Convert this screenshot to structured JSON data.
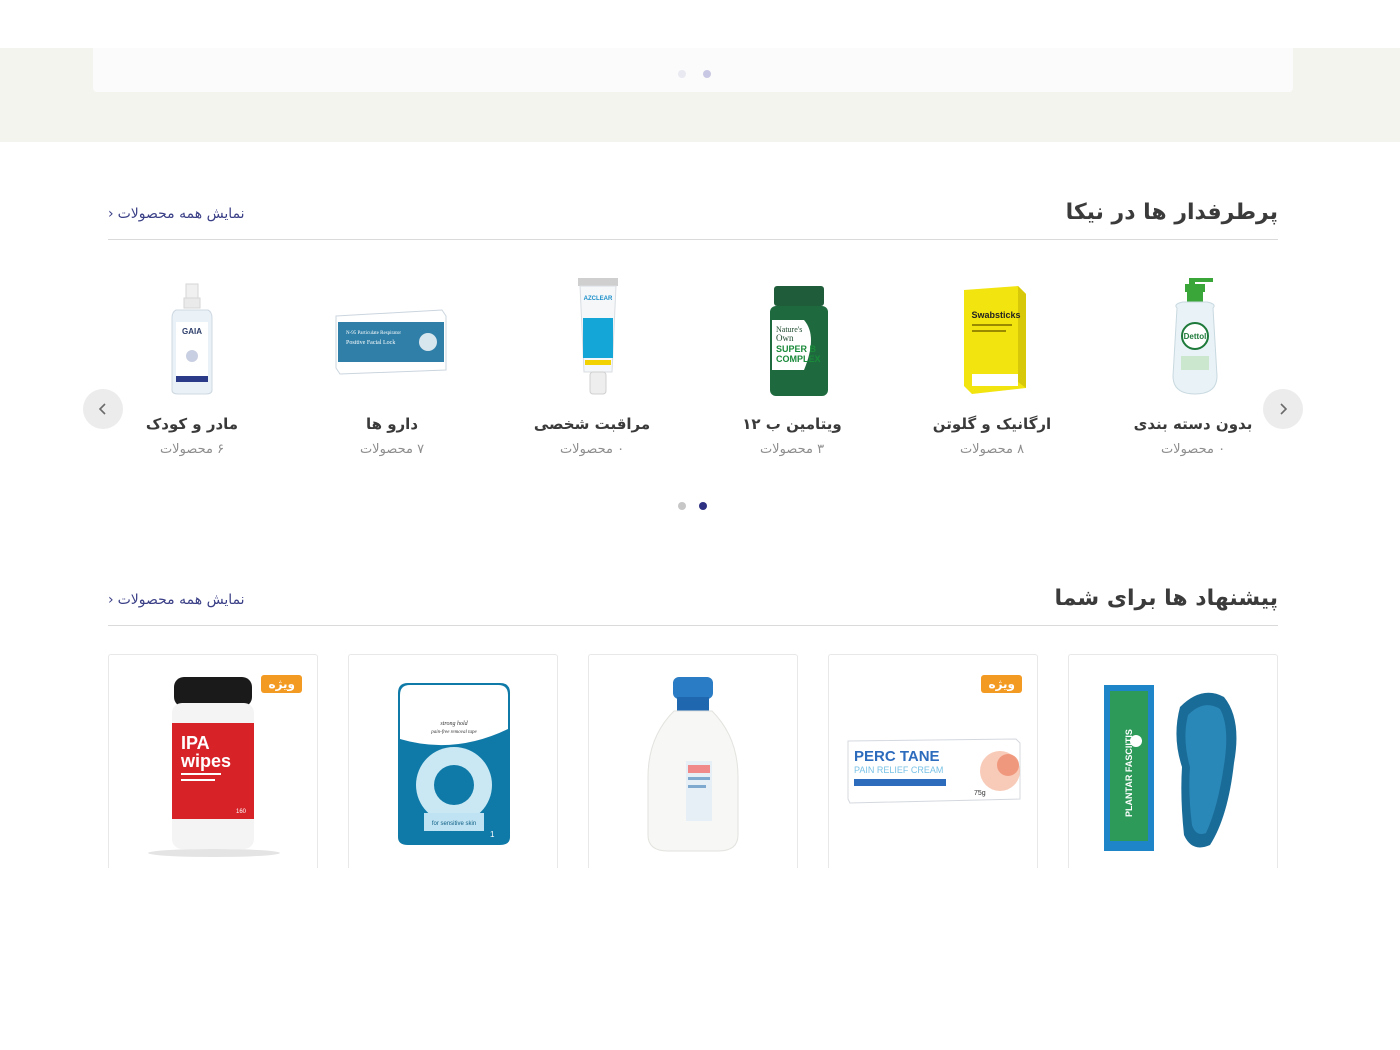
{
  "banner": {
    "dots": [
      {
        "active": false
      },
      {
        "active": true
      }
    ]
  },
  "popular": {
    "title": "پرطرفدار ها در نیکا",
    "see_all": "نمایش همه محصولات",
    "categories": [
      {
        "name": "بدون دسته بندی",
        "count": "۰ محصولات",
        "image": "dettol-hand-sanitizer"
      },
      {
        "name": "ارگانیک و گلوتن",
        "count": "۸ محصولات",
        "image": "swabsticks-box"
      },
      {
        "name": "ویتامین ب ۱۲",
        "count": "۳ محصولات",
        "image": "natures-own-super-b-complex"
      },
      {
        "name": "مراقبت شخصی",
        "count": "۰ محصولات",
        "image": "azclear-tube"
      },
      {
        "name": "دارو ها",
        "count": "۷ محصولات",
        "image": "respirator-mask-box"
      },
      {
        "name": "مادر و کودک",
        "count": "۶ محصولات",
        "image": "gaia-spray-bottle"
      }
    ],
    "dots": [
      {
        "active": true
      },
      {
        "active": false
      }
    ]
  },
  "suggested": {
    "title": "پیشنهاد ها برای شما",
    "see_all": "نمایش همه محصولات",
    "products": [
      {
        "image": "plantar-fasciitis-insole",
        "badge": null
      },
      {
        "image": "percutane-pain-relief-cream",
        "badge": "ویژه"
      },
      {
        "image": "white-lotion-bottle",
        "badge": null
      },
      {
        "image": "medical-tape-roll",
        "badge": null
      },
      {
        "image": "ipa-wipes-canister",
        "badge": "ویژه"
      }
    ]
  },
  "product_texts": {
    "ipa_line1": "IPA",
    "ipa_line2": "wipes",
    "ipa_count": "160",
    "perc_line1": "PERC  TANE",
    "perc_line2": "PAIN RELIEF CREAM",
    "perc_weight": "75g",
    "insole_label": "PLANTAR FASCIITIS",
    "tape_line1": "strong hold",
    "tape_line2": "pain-free removal tape",
    "tape_line3": "for sensitive skin",
    "tape_count": "1"
  },
  "cat_texts": {
    "dettol": "Dettol",
    "swab": "Swabsticks",
    "natures1": "Nature's",
    "natures2": "Own",
    "natures3": "SUPER B",
    "natures4": "COMPLEX",
    "azclear": "AZCLEAR",
    "mask1": "N-95 Particulate Respirator",
    "mask2": "Positive Facial Lock",
    "gaia": "GAIA"
  },
  "colors": {
    "accent": "#2e3182",
    "badge": "#f39a22",
    "band": "#f4f4ef"
  }
}
